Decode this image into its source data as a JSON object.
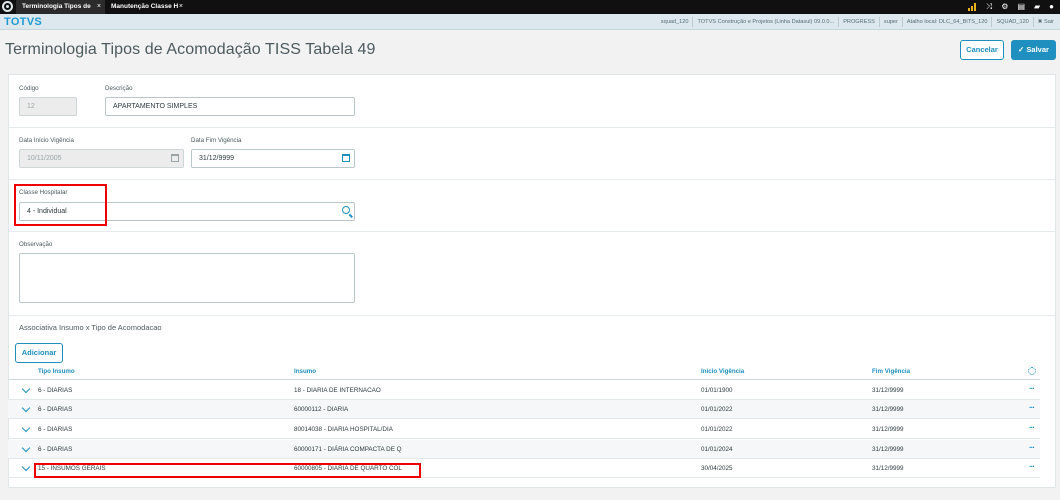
{
  "tabs": [
    {
      "label": "Terminologia Tipos de",
      "close": "×"
    },
    {
      "label": "Manutenção Classe H",
      "close": "×"
    }
  ],
  "system_bar": {
    "brand": "TOTVS",
    "items": [
      "squad_120",
      "TOTVS Construção e Projetos (Linha Datasul) 09.0.0...",
      "PROGRESS",
      "super",
      "Atalho local: DLC_64_BITS_120",
      "SQUAD_120",
      "Sair"
    ]
  },
  "page": {
    "title": "Terminologia Tipos de Acomodação TISS Tabela 49",
    "cancel_label": "Cancelar",
    "save_label": "Salvar",
    "save_check": "✓"
  },
  "form": {
    "codigo_label": "Código",
    "codigo_value": "12",
    "descricao_label": "Descrição",
    "descricao_value": "APARTAMENTO SIMPLES",
    "data_inicio_label": "Data Início Vigência",
    "data_inicio_value": "10/11/2005",
    "data_fim_label": "Data Fim Vigência",
    "data_fim_value": "31/12/9999",
    "classe_label": "Classe Hospitalar",
    "classe_value": "4 - Individual",
    "observacao_label": "Observação",
    "observacao_value": ""
  },
  "assoc": {
    "title": "Associativa Insumo x Tipo de Acomodacao",
    "add_label": "Adicionar",
    "columns": [
      "Tipo Insumo",
      "Insumo",
      "Início Vigência",
      "Fim Vigência"
    ],
    "rows": [
      {
        "tipo": "6 - DIARIAS",
        "insumo": "18 - DIARIA DE INTERNACAO",
        "inicio": "01/01/1900",
        "fim": "31/12/9999"
      },
      {
        "tipo": "6 - DIARIAS",
        "insumo": "60000112 - DIARIA",
        "inicio": "01/01/2022",
        "fim": "31/12/9999"
      },
      {
        "tipo": "6 - DIARIAS",
        "insumo": "80014038 - DIARIA HOSPITAL/DIA",
        "inicio": "01/01/2022",
        "fim": "31/12/9999"
      },
      {
        "tipo": "6 - DIARIAS",
        "insumo": "60000171 - DIÁRIA COMPACTA DE Q",
        "inicio": "01/01/2024",
        "fim": "31/12/9999"
      },
      {
        "tipo": "15 - INSUMOS GERAIS",
        "insumo": "60000805 - DIARIA DE QUARTO COL",
        "inicio": "30/04/2025",
        "fim": "31/12/9999"
      }
    ],
    "more_glyph": "···"
  },
  "colors": {
    "accent": "#1e8fbf",
    "highlight": "#e00000",
    "brand": "#1e9ad1"
  }
}
